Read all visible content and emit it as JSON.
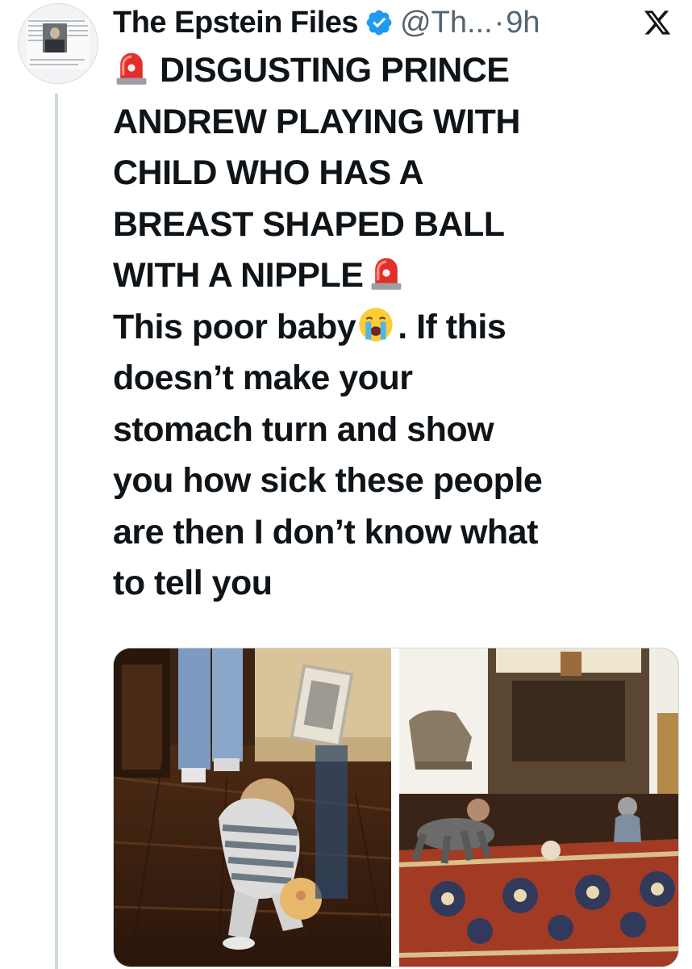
{
  "post": {
    "author_name": "The Epstein Files",
    "handle": "@Th...",
    "separator": "·",
    "time": "9h",
    "headline_lines": [
      "DISGUSTING PRINCE",
      "ANDREW PLAYING WITH",
      "CHILD WHO HAS A",
      "BREAST SHAPED BALL",
      "WITH A NIPPLE"
    ],
    "body_first": "This poor baby",
    "body_after_emoji": ". If this",
    "body_lines": [
      "doesn’t make your",
      "stomach turn and show",
      "you how sick these people",
      "are then I don’t know what",
      "to tell you"
    ]
  },
  "icons": {
    "verified": "verified-badge-icon",
    "platform": "x-logo-icon",
    "siren": "police-siren-emoji",
    "cry": "loudly-crying-face-emoji"
  },
  "colors": {
    "verified_blue": "#1d9bf0",
    "muted_text": "#536471",
    "siren_red": "#e0302c"
  }
}
